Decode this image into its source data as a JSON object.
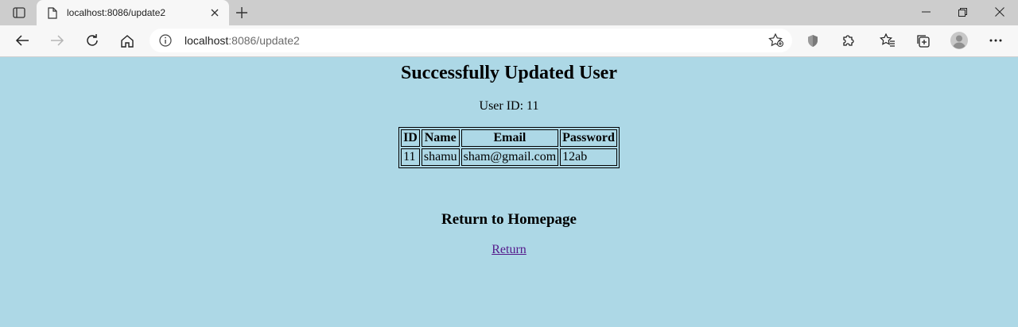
{
  "browser": {
    "tab_title": "localhost:8086/update2",
    "url_host": "localhost",
    "url_path": ":8086/update2"
  },
  "page": {
    "heading": "Successfully Updated User",
    "user_id_line": "User ID: 11",
    "table": {
      "headers": [
        "ID",
        "Name",
        "Email",
        "Password"
      ],
      "row": [
        "11",
        "shamu",
        "sham@gmail.com",
        "12ab"
      ]
    },
    "return_heading": "Return to Homepage",
    "return_link": "Return"
  },
  "colors": {
    "background": "#add8e6",
    "link_visited": "#551a8b"
  }
}
